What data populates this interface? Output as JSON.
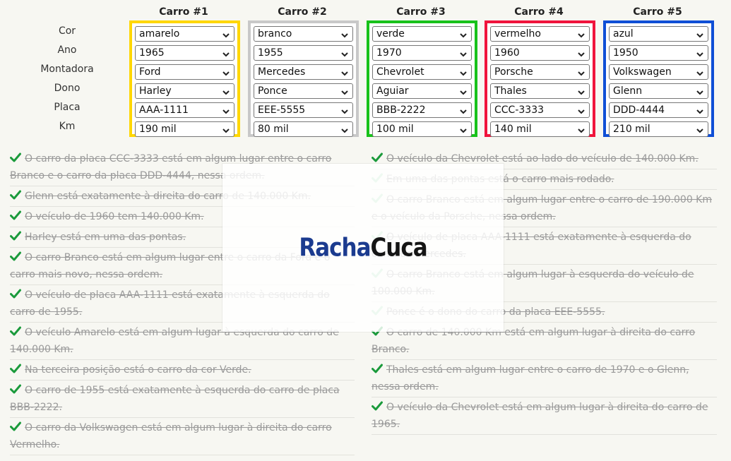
{
  "row_labels": [
    "Cor",
    "Ano",
    "Montadora",
    "Dono",
    "Placa",
    "Km"
  ],
  "cars": [
    {
      "header": "Carro #1",
      "border_color": "#ffd700",
      "values": [
        "amarelo",
        "1965",
        "Ford",
        "Harley",
        "AAA-1111",
        "190 mil"
      ]
    },
    {
      "header": "Carro #2",
      "border_color": "#c8c8c8",
      "values": [
        "branco",
        "1955",
        "Mercedes",
        "Ponce",
        "EEE-5555",
        "80 mil"
      ]
    },
    {
      "header": "Carro #3",
      "border_color": "#18c21b",
      "values": [
        "verde",
        "1970",
        "Chevrolet",
        "Aguiar",
        "BBB-2222",
        "100 mil"
      ]
    },
    {
      "header": "Carro #4",
      "border_color": "#f0143c",
      "values": [
        "vermelho",
        "1960",
        "Porsche",
        "Thales",
        "CCC-3333",
        "140 mil"
      ]
    },
    {
      "header": "Carro #5",
      "border_color": "#0f4fd6",
      "values": [
        "azul",
        "1950",
        "Volkswagen",
        "Glenn",
        "DDD-4444",
        "210 mil"
      ]
    }
  ],
  "check_color": "#1a9a3b",
  "clues_left": [
    {
      "text": "O carro da placa CCC-3333 está em algum lugar entre o carro Branco e o carro da placa DDD-4444, nessa ordem.",
      "solid": true
    },
    {
      "text": "Glenn está exatamente à direita do carro de 140.000 Km.",
      "solid": true
    },
    {
      "text": "O veículo de 1960 tem 140.000 Km.",
      "solid": true
    },
    {
      "text": "Harley está em uma das pontas.",
      "solid": true
    },
    {
      "text": "O carro Branco está em algum lugar entre o carro da Ford e o carro mais novo, nessa ordem.",
      "solid": true
    },
    {
      "text": "O veículo de placa AAA-1111 está exatamente à esquerda do carro de 1955.",
      "solid": true
    },
    {
      "text": "O veículo Amarelo está em algum lugar à esquerda do carro de 140.000 Km.",
      "solid": true
    },
    {
      "text": "Na terceira posição está o carro da cor Verde.",
      "solid": true
    },
    {
      "text": "O carro de 1955 está exatamente à esquerda do carro de placa BBB-2222.",
      "solid": true
    },
    {
      "text": "O carro da Volkswagen está em algum lugar à direita do carro Vermelho.",
      "solid": true
    }
  ],
  "clues_right": [
    {
      "text": "O veículo da Chevrolet está ao lado do veículo de 140.000 Km.",
      "solid": true
    },
    {
      "text": "Em uma das pontas está o carro mais rodado.",
      "solid": false
    },
    {
      "text": "O carro Branco está em algum lugar entre o carro de 190.000 Km e o veículo da Porsche, nessa ordem.",
      "solid": false
    },
    {
      "text": "O veículo de placa AAA-1111 está exatamente à esquerda do carro da Mercedes.",
      "solid": false
    },
    {
      "text": "O carro Branco está em algum lugar à esquerda do veículo de 100.000 Km.",
      "solid": false
    },
    {
      "text": "Ponce é o dono do carro da placa EEE-5555.",
      "solid": false
    },
    {
      "text": "O carro de 140.000 Km está em algum lugar à direita do carro Branco.",
      "solid": true
    },
    {
      "text": "Thales está em algum lugar entre o carro de 1970 e o Glenn, nessa ordem.",
      "solid": true
    },
    {
      "text": "O veículo da Chevrolet está em algum lugar à direita do carro de 1965.",
      "solid": true
    }
  ],
  "logo": {
    "part1": "Racha",
    "part2": "Cuca"
  }
}
